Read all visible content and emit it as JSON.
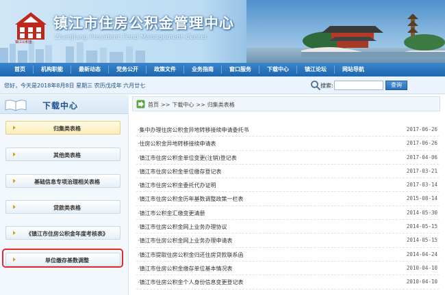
{
  "header": {
    "title": "镇江市住房公积金管理中心",
    "subtitle": "Zhenjiang Provident Fund Management Center",
    "logo_caption": "镇江公积金"
  },
  "nav": {
    "items": [
      "首页",
      "机构职能",
      "最新动态",
      "党务公开",
      "政策文件",
      "业务指南",
      "窗口服务",
      "下载中心",
      "镇江论坛",
      "网站导航"
    ]
  },
  "infobar": {
    "date_text": "您好，今天是2018年8月8日 星期三 农历戊戌年 六月廿七",
    "search_label": "搜索:",
    "search_value": "",
    "search_button": "查询"
  },
  "sidebar": {
    "title": "下载中心",
    "items": [
      {
        "label": "归集类表格",
        "active": true
      },
      {
        "label": "其他类表格",
        "active": false
      },
      {
        "label": "基础信息专项治理相关表格",
        "active": false
      },
      {
        "label": "贷款类表格",
        "active": false
      },
      {
        "label": "《镇江市住房公积金年度考核表》",
        "active": false
      },
      {
        "label": "单位缴存基数调整",
        "active": false
      }
    ]
  },
  "breadcrumb": {
    "parts": [
      "首页",
      "下载中心",
      "归集类表格"
    ],
    "separator": ">>"
  },
  "list": {
    "rows": [
      {
        "title": "·集中办理住房公积金异地转移接续申请委托书",
        "date": "2017-06-26"
      },
      {
        "title": "·住房公积金异地转移接续申请表",
        "date": "2017-06-26"
      },
      {
        "title": "·镇江市住房公积金单位变更(注销)登记表",
        "date": "2017-04-06"
      },
      {
        "title": "·镇江市住房公积金单位缴存登记表",
        "date": "2017-03-21"
      },
      {
        "title": "·镇江市住房公积金委托代办证明",
        "date": "2017-03-14"
      },
      {
        "title": "·镇江市住房公积金历年基数调整政策一栏表",
        "date": "2015-08-14"
      },
      {
        "title": "·镇江市公积金汇缴变更清册",
        "date": "2014-05-30"
      },
      {
        "title": "·镇江市住房公积金网上业务办理协议",
        "date": "2014-05-15"
      },
      {
        "title": "·镇江市住房公积金网上业务办理申请表",
        "date": "2014-05-15"
      },
      {
        "title": "·镇江市提取住房公积金归还住房贷款联系函",
        "date": "2014-04-24"
      },
      {
        "title": "·镇江市住房公积金缴存单位基本情况表",
        "date": "2010-04-10"
      },
      {
        "title": "·镇江市住房公积金个人身份信息变更登记表",
        "date": "2010-04-10"
      }
    ]
  },
  "colors": {
    "nav_bg": "#1e66ad",
    "highlight": "#e02b2b",
    "accent_text": "#1b4f8a"
  }
}
